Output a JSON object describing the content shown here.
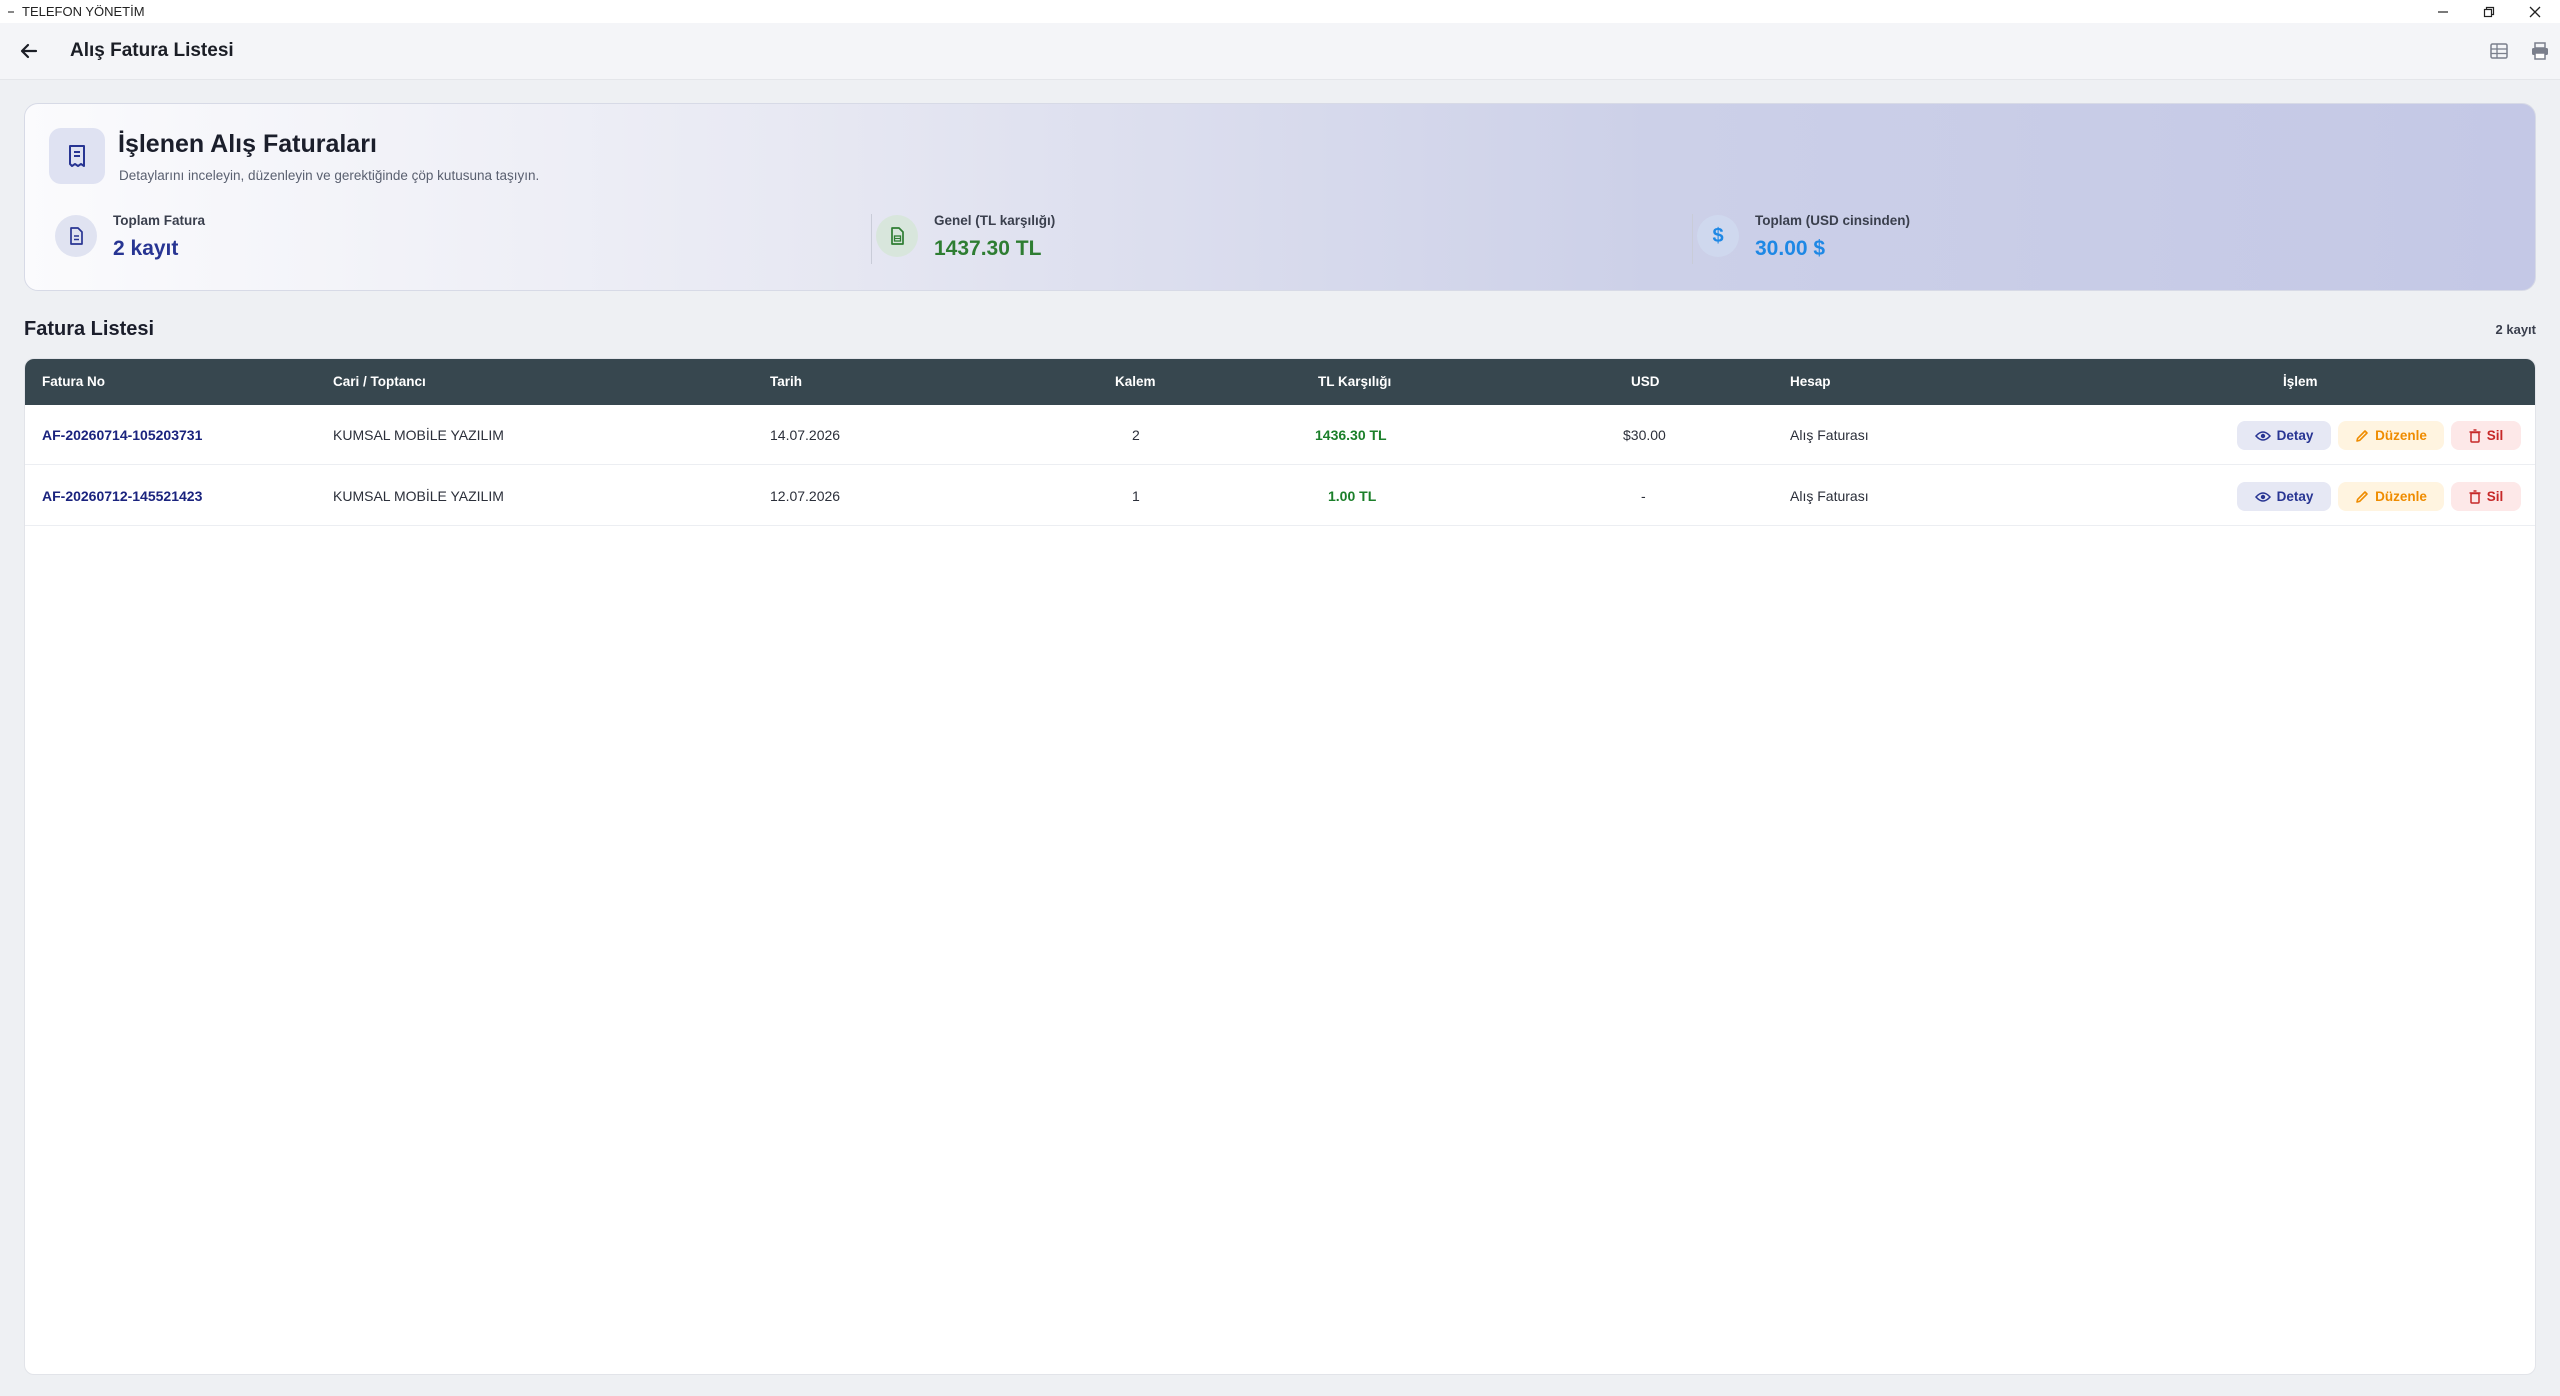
{
  "window": {
    "title": "TELEFON YÖNETİM"
  },
  "appbar": {
    "title": "Alış Fatura Listesi"
  },
  "hero": {
    "title": "İşlenen Alış Faturaları",
    "subtitle": "Detaylarını inceleyin, düzenleyin ve gerektiğinde çöp kutusuna taşıyın.",
    "stats": [
      {
        "label": "Toplam Fatura",
        "value": "2 kayıt",
        "color": "#283593",
        "icon": "document-icon"
      },
      {
        "label": "Genel (TL karşılığı)",
        "value": "1437.30 TL",
        "color": "#2e7d32",
        "icon": "invoice-icon"
      },
      {
        "label": "Toplam (USD cinsinden)",
        "value": "30.00 $",
        "color": "#1e88e5",
        "icon": "dollar-icon"
      }
    ]
  },
  "list": {
    "title": "Fatura Listesi",
    "count": "2 kayıt",
    "columns": [
      "Fatura No",
      "Cari / Toptancı",
      "Tarih",
      "Kalem",
      "TL Karşılığı",
      "USD",
      "Hesap",
      "İşlem"
    ],
    "rows": [
      {
        "no": "AF-20260714-105203731",
        "cari": "KUMSAL MOBİLE YAZILIM",
        "tarih": "14.07.2026",
        "kalem": "2",
        "tl": "1436.30 TL",
        "usd": "$30.00",
        "hesap": "Alış Faturası"
      },
      {
        "no": "AF-20260712-145521423",
        "cari": "KUMSAL MOBİLE YAZILIM",
        "tarih": "12.07.2026",
        "kalem": "1",
        "tl": "1.00 TL",
        "usd": "-",
        "hesap": "Alış Faturası"
      }
    ],
    "actions": {
      "detail": "Detay",
      "edit": "Düzenle",
      "delete": "Sil"
    }
  },
  "colors": {
    "header_bg": "#37474f",
    "accent_blue": "#283593",
    "green": "#2e7d32",
    "orange": "#ef8c00",
    "red": "#c62828"
  }
}
